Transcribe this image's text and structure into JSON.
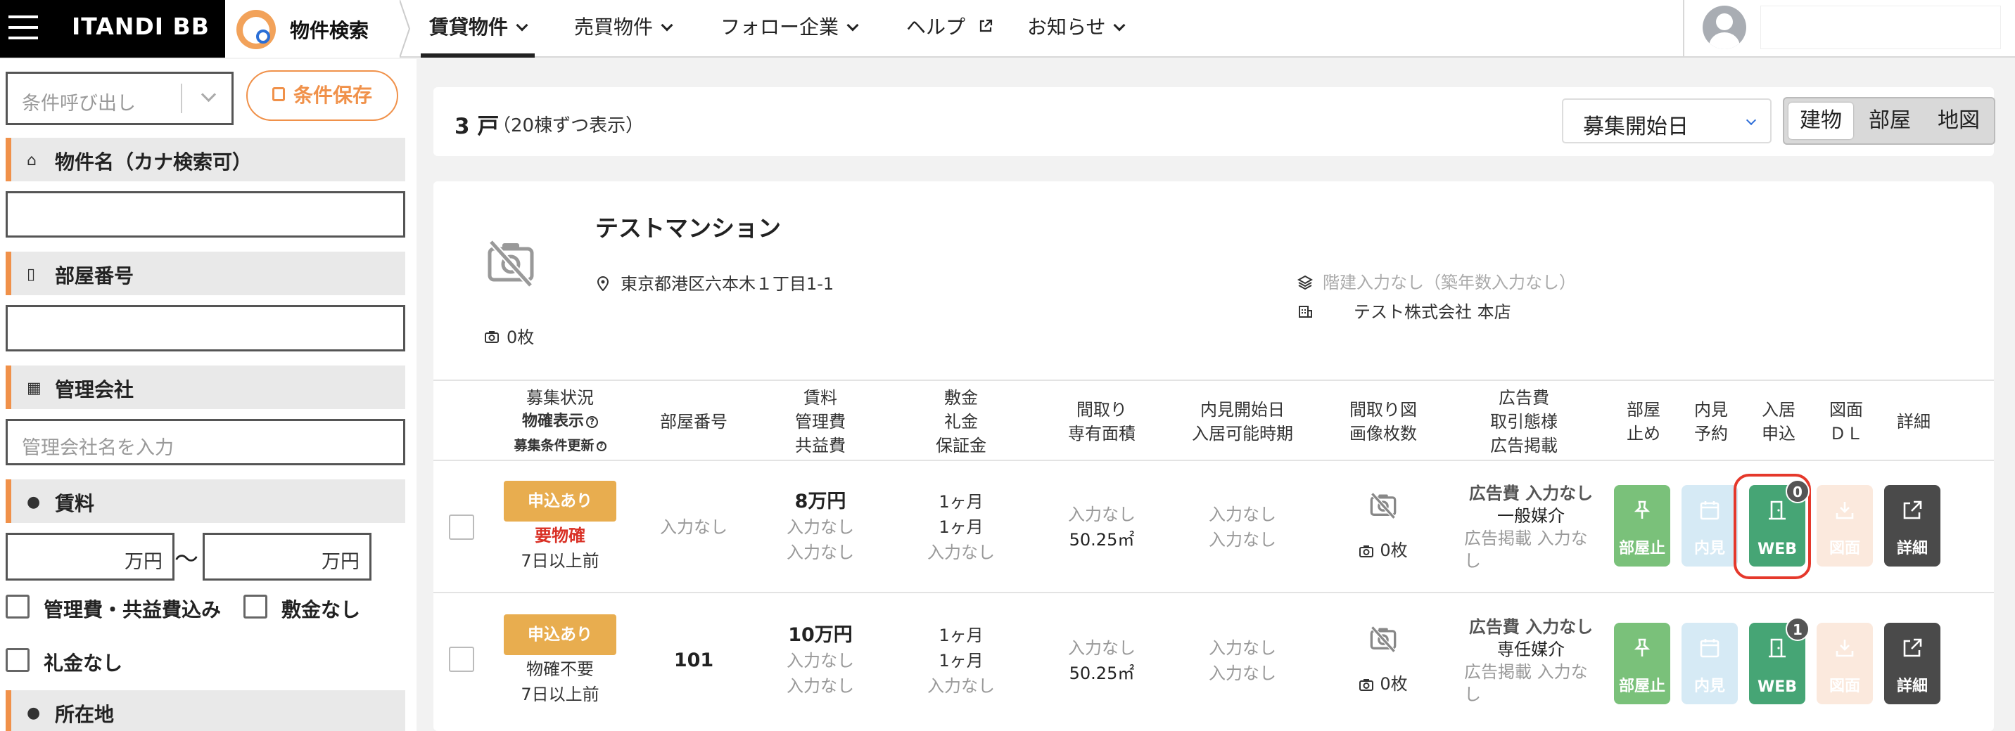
{
  "topbar": {
    "brand": "ITANDI BB",
    "app_title": "物件検索",
    "nav": [
      {
        "label": "賃貸物件",
        "active": true
      },
      {
        "label": "売買物件"
      },
      {
        "label": "フォロー企業"
      },
      {
        "label": "ヘルプ"
      },
      {
        "label": "お知らせ"
      }
    ]
  },
  "sidebar": {
    "recall_placeholder": "条件呼び出し",
    "save_label": "条件保存",
    "sections": {
      "property_name": "物件名（カナ検索可）",
      "room_number": "部屋番号",
      "management": "管理会社",
      "management_placeholder": "管理会社名を入力",
      "rent": "賃料",
      "rent_unit": "万円",
      "tilde": "〜",
      "location": "所在地"
    },
    "checks": {
      "fee_included": "管理費・共益費込み",
      "no_deposit": "敷金なし",
      "no_key_money": "礼金なし"
    }
  },
  "results": {
    "count": "3 戸",
    "count_sub": "（20棟ずつ表示）",
    "sort": "募集開始日",
    "views": [
      "建物",
      "部屋",
      "地図"
    ],
    "active_view": "建物"
  },
  "building": {
    "name": "テストマンション",
    "photo_count": "0枚",
    "address": "東京都港区六本木１丁目1-1",
    "floors": "階建入力なし（築年数入力なし）",
    "company": "テスト株式会社 本店"
  },
  "table": {
    "headers": {
      "status": [
        "募集状況",
        "物確表示",
        "募集条件更新"
      ],
      "room": "部屋番号",
      "rent": [
        "賃料",
        "管理費",
        "共益費"
      ],
      "deposit": [
        "敷金",
        "礼金",
        "保証金"
      ],
      "layout": [
        "間取り",
        "専有面積"
      ],
      "viewing": [
        "内見開始日",
        "入居可能時期"
      ],
      "floorplan": [
        "間取り図",
        "画像枚数"
      ],
      "ad": [
        "広告費",
        "取引態様",
        "広告掲載"
      ],
      "stop": [
        "部屋",
        "止め"
      ],
      "reserve": [
        "内見",
        "予約"
      ],
      "apply": [
        "入居",
        "申込"
      ],
      "drawing": [
        "図面",
        "ＤＬ"
      ],
      "detail": "詳細"
    },
    "rows": [
      {
        "badge": "申込あり",
        "confirm": "要物確",
        "updated": "7日以上前",
        "room": "入力なし",
        "rent": "8万円",
        "mgmt": "入力なし",
        "common": "入力なし",
        "deposit": "1ヶ月",
        "key": "1ヶ月",
        "guarantee": "入力なし",
        "layout": "入力なし",
        "area": "50.25㎡",
        "view_start": "入力なし",
        "move_in": "入力なし",
        "plan_count": "0枚",
        "ad_fee": "広告費 入力なし",
        "deal": "一般媒介",
        "ad_post": "広告掲載 入力なし",
        "web_count": "0"
      },
      {
        "badge": "申込あり",
        "confirm": "物確不要",
        "updated": "7日以上前",
        "room": "101",
        "rent": "10万円",
        "mgmt": "入力なし",
        "common": "入力なし",
        "deposit": "1ヶ月",
        "key": "1ヶ月",
        "guarantee": "入力なし",
        "layout": "入力なし",
        "area": "50.25㎡",
        "view_start": "入力なし",
        "move_in": "入力なし",
        "plan_count": "0枚",
        "ad_fee": "広告費 入力なし",
        "deal": "専任媒介",
        "ad_post": "広告掲載 入力なし",
        "web_count": "1"
      }
    ],
    "buttons": {
      "stop": "部屋止",
      "reserve": "内見",
      "web": "WEB",
      "drawing": "図面",
      "detail": "詳細"
    }
  },
  "icons": {
    "menu": "hamburger-icon",
    "external": "external-link-icon",
    "pin": "location-pin-icon",
    "camera": "camera-icon",
    "no_photo": "no-photo-icon",
    "layers": "layers-icon",
    "building": "building-icon"
  },
  "colors": {
    "accent": "#f0914a",
    "badge": "#e8ad4f",
    "web_green": "#46a575",
    "highlight_ring": "#e5382b"
  }
}
